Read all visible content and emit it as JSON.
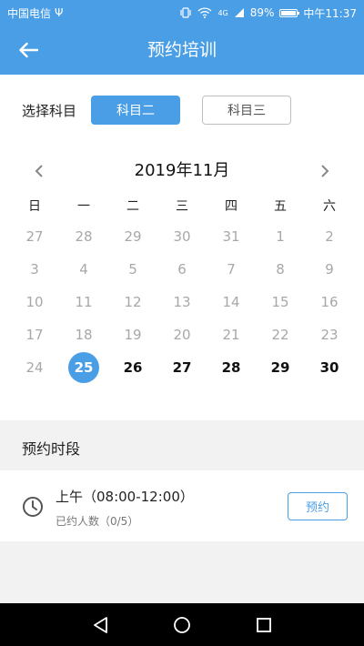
{
  "status": {
    "carrier": "中国电信",
    "usb_glyph": "Ψ",
    "network": "4G",
    "battery": "89%",
    "battery_level": 0.89,
    "time": "中午11:37"
  },
  "appbar": {
    "title": "预约培训",
    "back_icon": "arrow-left-icon"
  },
  "subject": {
    "label": "选择科目",
    "options": [
      "科目二",
      "科目三"
    ],
    "selected": "科目二"
  },
  "calendar": {
    "month_label": "2019年11月",
    "weekdays": [
      "日",
      "一",
      "二",
      "三",
      "四",
      "五",
      "六"
    ],
    "days": [
      "27",
      "28",
      "29",
      "30",
      "31",
      "1",
      "2",
      "3",
      "4",
      "5",
      "6",
      "7",
      "8",
      "9",
      "10",
      "11",
      "12",
      "13",
      "14",
      "15",
      "16",
      "17",
      "18",
      "19",
      "20",
      "21",
      "22",
      "23",
      "24",
      "25",
      "26",
      "27",
      "28",
      "29",
      "30"
    ],
    "selected_day": "25",
    "selectable_from_index": 29
  },
  "booking": {
    "section_title": "预约时段",
    "slots": [
      {
        "title": "上午（08:00-12:00）",
        "count": "已约人数（0/5）",
        "button": "预约"
      }
    ]
  },
  "colors": {
    "accent": "#4a9ee6",
    "muted_day": "#a8a8a8",
    "active_day": "#111111"
  }
}
